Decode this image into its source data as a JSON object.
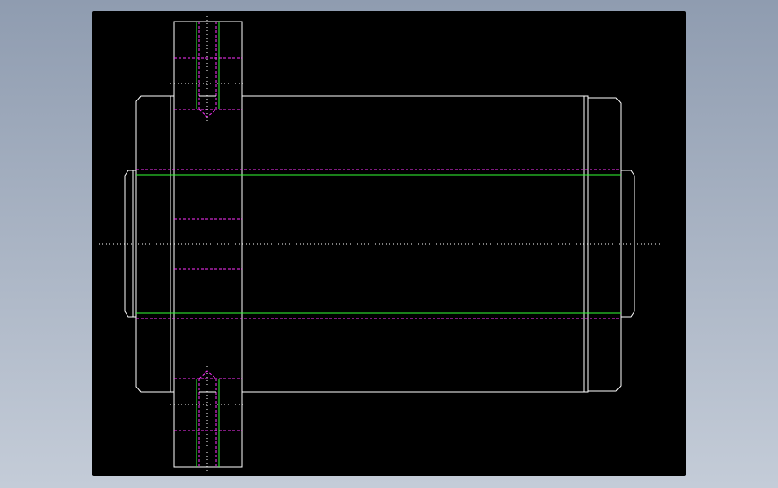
{
  "viewport": {
    "background_top": "#8f9cb0",
    "background_bottom": "#c4ccd8",
    "sheet_color": "#000000"
  },
  "drawing": {
    "colors": {
      "outline": "#ffffff",
      "hidden_line": "#ff33ff",
      "thread_line": "#33ff33",
      "centerline": "#ffffff"
    }
  }
}
